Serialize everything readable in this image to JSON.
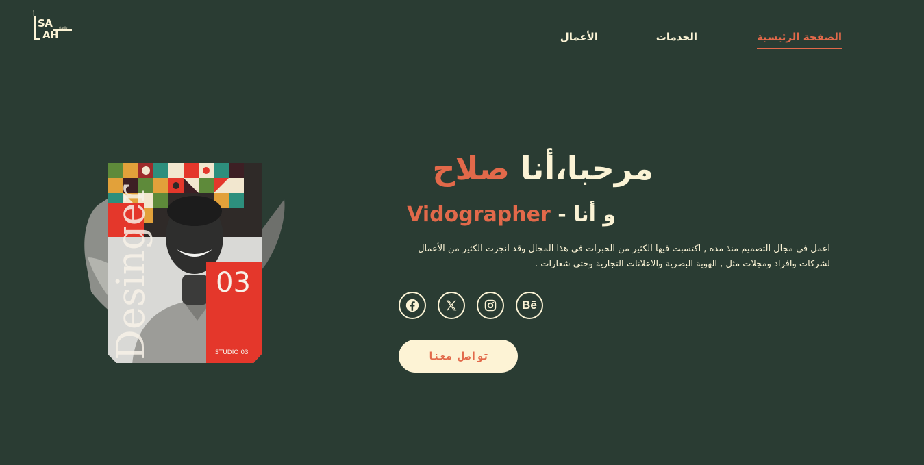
{
  "logo": {
    "mark": "أ",
    "line1": "SA",
    "line2": "AH",
    "tiny": "studio"
  },
  "nav": {
    "home": "الصفحة الرئيسية",
    "services": "الخدمات",
    "works": "الأعمال"
  },
  "hero": {
    "title_prefix": "مرحبا،أنا",
    "title_name": "صلاح",
    "subtitle_prefix": "و أنا - ",
    "subtitle_role": "Vidographer",
    "bio": "اعمل في مجال التصميم منذ مدة , اكتسبت فيها الكثير من الخبرات في هذا المجال وقد انجزت الكثير من الأعمال لشركات وافراد ومجلات مثل , الهوية البصرية والاعلانات التجارية وحتي شعارات .",
    "cta": "تواصل معنا"
  },
  "poster": {
    "word": "Desinger",
    "number": "03",
    "studio": "STUDIO 03"
  },
  "socials": [
    {
      "icon": "facebook-icon"
    },
    {
      "icon": "x-icon"
    },
    {
      "icon": "instagram-icon"
    },
    {
      "icon": "behance-icon",
      "label": "Bē"
    }
  ],
  "colors": {
    "background": "#2a3c33",
    "accent": "#e2694a",
    "cream": "#fbf3d5",
    "poster_red": "#e4372b"
  }
}
